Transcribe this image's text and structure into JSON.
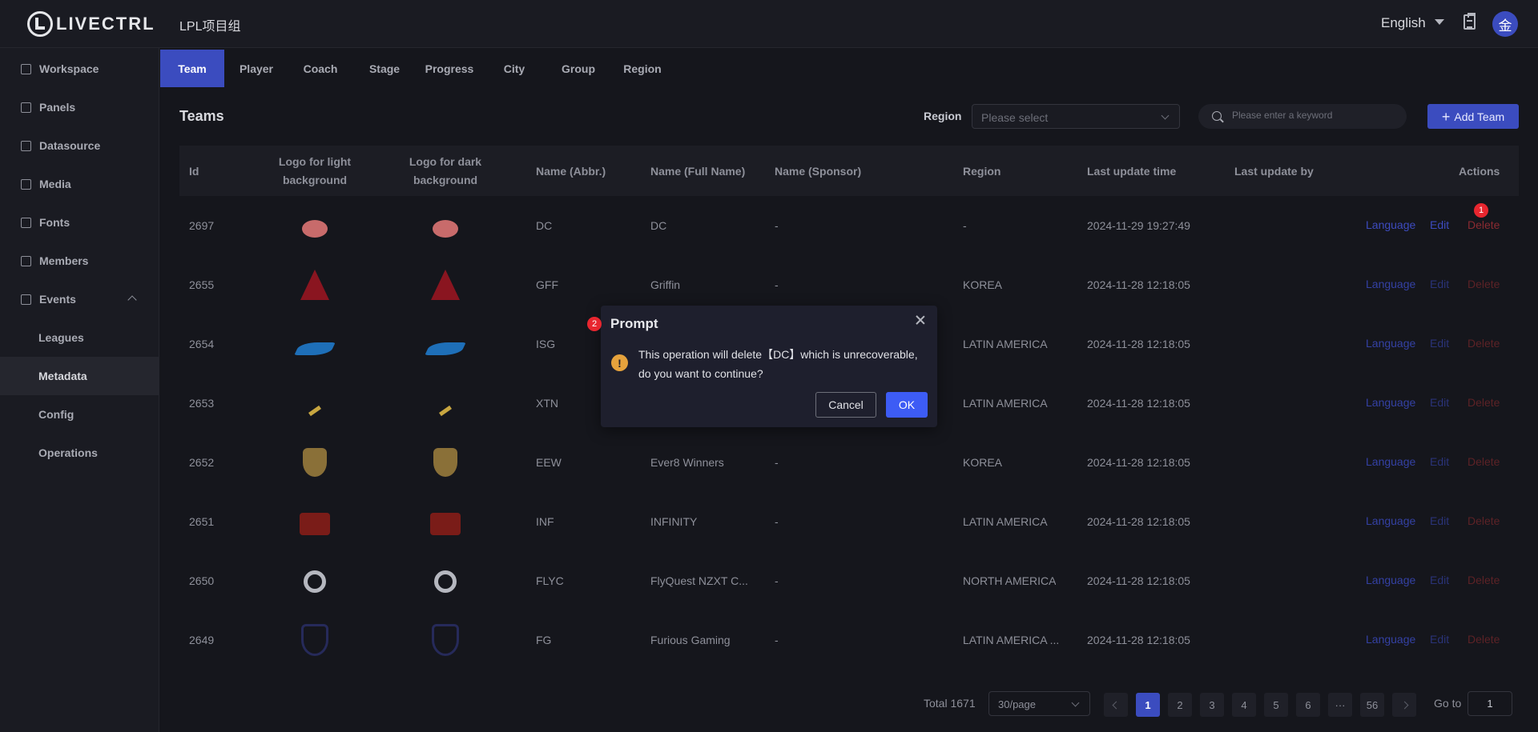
{
  "app": {
    "logo_text": "LIVECTRL",
    "project_title": "LPL项目组",
    "language": "English",
    "avatar_text": "金"
  },
  "sidebar": {
    "items": [
      {
        "label": "Workspace"
      },
      {
        "label": "Panels"
      },
      {
        "label": "Datasource"
      },
      {
        "label": "Media"
      },
      {
        "label": "Fonts"
      },
      {
        "label": "Members"
      },
      {
        "label": "Events"
      },
      {
        "label": "Leagues"
      },
      {
        "label": "Metadata"
      },
      {
        "label": "Config"
      },
      {
        "label": "Operations"
      }
    ]
  },
  "tabs": [
    {
      "label": "Team"
    },
    {
      "label": "Player"
    },
    {
      "label": "Coach"
    },
    {
      "label": "Stage"
    },
    {
      "label": "Progress"
    },
    {
      "label": "City"
    },
    {
      "label": "Group"
    },
    {
      "label": "Region"
    }
  ],
  "toolbar": {
    "title": "Teams",
    "region_label": "Region",
    "region_placeholder": "Please select",
    "search_placeholder": "Please enter a keyword",
    "add_label": "Add Team"
  },
  "table": {
    "headers": {
      "id": "Id",
      "logo_light": "Logo for light background",
      "logo_dark": "Logo for dark background",
      "abbr": "Name (Abbr.)",
      "full": "Name (Full Name)",
      "sponsor": "Name (Sponsor)",
      "region": "Region",
      "updated": "Last update time",
      "updated_by": "Last update by",
      "actions": "Actions"
    },
    "action_labels": {
      "language": "Language",
      "edit": "Edit",
      "delete": "Delete"
    },
    "rows": [
      {
        "id": "2697",
        "abbr": "DC",
        "full": "DC",
        "sponsor": "-",
        "region": "-",
        "updated": "2024-11-29 19:27:49",
        "updated_by": "",
        "logo_icon": "cat-logo"
      },
      {
        "id": "2655",
        "abbr": "GFF",
        "full": "Griffin",
        "sponsor": "-",
        "region": "KOREA",
        "updated": "2024-11-28 12:18:05",
        "updated_by": "",
        "logo_icon": "wolf-logo"
      },
      {
        "id": "2654",
        "abbr": "ISG",
        "full": "",
        "sponsor": "",
        "region": "LATIN AMERICA",
        "updated": "2024-11-28 12:18:05",
        "updated_by": "",
        "logo_icon": "shark-logo"
      },
      {
        "id": "2653",
        "abbr": "XTN",
        "full": "",
        "sponsor": "",
        "region": "LATIN AMERICA",
        "updated": "2024-11-28 12:18:05",
        "updated_by": "",
        "logo_icon": "slash-logo"
      },
      {
        "id": "2652",
        "abbr": "EEW",
        "full": "Ever8 Winners",
        "sponsor": "-",
        "region": "KOREA",
        "updated": "2024-11-28 12:18:05",
        "updated_by": "",
        "logo_icon": "crest-logo"
      },
      {
        "id": "2651",
        "abbr": "INF",
        "full": "INFINITY",
        "sponsor": "-",
        "region": "LATIN AMERICA",
        "updated": "2024-11-28 12:18:05",
        "updated_by": "",
        "logo_icon": "infinity-logo"
      },
      {
        "id": "2650",
        "abbr": "FLYC",
        "full": "FlyQuest NZXT C...",
        "sponsor": "-",
        "region": "NORTH AMERICA",
        "updated": "2024-11-28 12:18:05",
        "updated_by": "",
        "logo_icon": "flyquest-logo"
      },
      {
        "id": "2649",
        "abbr": "FG",
        "full": "Furious Gaming",
        "sponsor": "-",
        "region": "LATIN AMERICA ...",
        "updated": "2024-11-28 12:18:05",
        "updated_by": "",
        "logo_icon": "fg-logo"
      }
    ]
  },
  "pagination": {
    "total": "Total 1671",
    "page_size": "30/page",
    "pages": [
      "1",
      "2",
      "3",
      "4",
      "5",
      "6",
      "···",
      "56"
    ],
    "goto_label": "Go to",
    "goto_value": "1"
  },
  "modal": {
    "badge": "2",
    "title": "Prompt",
    "message": "This operation will delete【DC】which is unrecoverable, do you want to continue?",
    "cancel": "Cancel",
    "ok": "OK"
  },
  "badges": {
    "delete_badge": "1"
  },
  "colors": {
    "accent": "#3b4cbf",
    "ok_button": "#3d5cf5",
    "warning": "#e6a23c",
    "danger_badge": "#e8262f"
  }
}
